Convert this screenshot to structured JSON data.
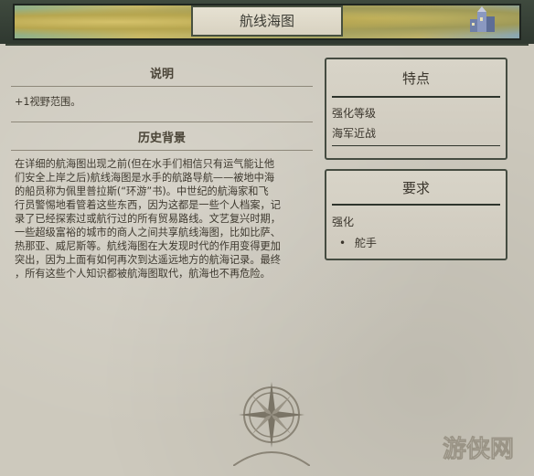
{
  "window": {
    "title": "航线海图"
  },
  "description": {
    "heading": "说明",
    "text": "+1视野范围。"
  },
  "history": {
    "heading": "历史背景",
    "lines": [
      "在详细的航海图出现之前(但在水手们相信只有运气能让他",
      "们安全上岸之后)航线海图是水手的航路导航——被地中海",
      "的船员称为佩里普拉斯(“环游”书)。中世纪的航海家和飞",
      "行员警惕地看管着这些东西，因为这都是一些个人档案，记",
      "录了已经探索过或航行过的所有贸易路线。文艺复兴时期，",
      "一些超级富裕的城市的商人之间共享航线海图，比如比萨、",
      "热那亚、威尼斯等。航线海图在大发现时代的作用变得更加",
      "突出，因为上面有如何再次到达遥远地方的航海记录。最终",
      "，所有这些个人知识都被航海图取代，航海也不再危险。"
    ]
  },
  "features_panel": {
    "heading": "特点",
    "item1": "强化等级",
    "item2": "海军近战"
  },
  "requirements_panel": {
    "heading": "要求",
    "category": "强化",
    "item": "舵手"
  },
  "watermark": {
    "text": "游侠网"
  }
}
